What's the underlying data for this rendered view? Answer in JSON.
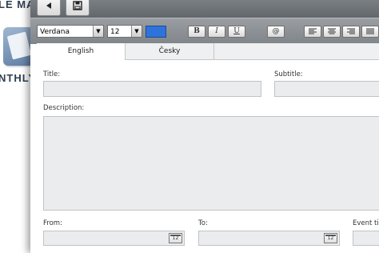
{
  "background": {
    "title_fragment": "LE MAN",
    "subtitle_fragment": "NTHLY"
  },
  "toolbar": {
    "font_family": "Verdana",
    "font_size": "12",
    "color_value": "#2e73d9",
    "bold_label": "B",
    "italic_label": "I",
    "underline_label": "U",
    "link_label": "@"
  },
  "tabs": [
    {
      "label": "English",
      "active": true
    },
    {
      "label": "Česky",
      "active": false
    }
  ],
  "form": {
    "title_label": "Title:",
    "title_value": "",
    "subtitle_label": "Subtitle:",
    "subtitle_value": "",
    "description_label": "Description:",
    "description_value": "",
    "from_label": "From:",
    "from_value": "",
    "to_label": "To:",
    "to_value": "",
    "event_time_label": "Event tim",
    "calendar_label": "12"
  }
}
